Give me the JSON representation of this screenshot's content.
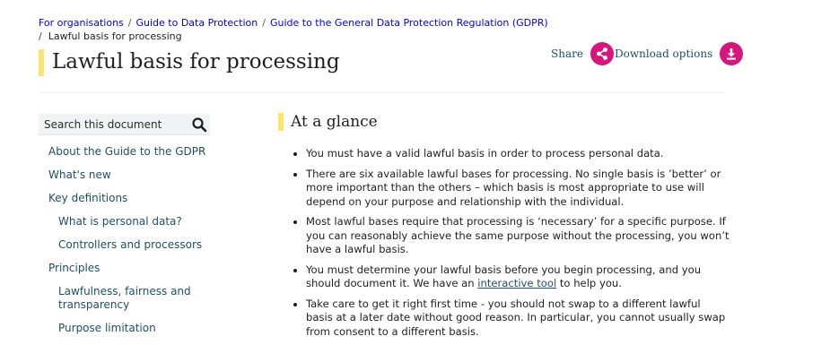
{
  "breadcrumb": {
    "items": [
      "For organisations",
      "Guide to Data Protection",
      "Guide to the General Data Protection Regulation (GDPR)",
      "Lawful basis for processing"
    ],
    "separator": "/"
  },
  "page": {
    "title": "Lawful basis for processing"
  },
  "actions": {
    "share_label": "Share",
    "download_label": "Download options"
  },
  "search": {
    "placeholder": "Search this document"
  },
  "sidebar": {
    "items": [
      {
        "label": "About the Guide to the GDPR",
        "level": 1
      },
      {
        "label": "What's new",
        "level": 1
      },
      {
        "label": "Key definitions",
        "level": 1
      },
      {
        "label": "What is personal data?",
        "level": 2
      },
      {
        "label": "Controllers and processors",
        "level": 2
      },
      {
        "label": "Principles",
        "level": 1
      },
      {
        "label": "Lawfulness, fairness and transparency",
        "level": 2
      },
      {
        "label": "Purpose limitation",
        "level": 2
      }
    ]
  },
  "main": {
    "section_title": "At a glance",
    "bullets": [
      "You must have a valid lawful basis in order to process personal data.",
      "There are six available lawful bases for processing. No single basis is ’better’ or more important than the others – which basis is most appropriate to use will depend on your purpose and relationship with the individual.",
      "Most lawful bases require that processing is ‘necessary’ for a specific purpose. If you can reasonably achieve the same purpose without the processing, you won’t have a lawful basis.",
      {
        "before": "You must determine your lawful basis before you begin processing, and you should document it. We have an ",
        "link": "interactive tool",
        "after": " to help you."
      },
      "Take care to get it right first time - you should not swap to a different lawful basis at a later date without good reason. In particular, you cannot usually swap from consent to a different basis."
    ]
  },
  "colors": {
    "accent_yellow": "#fbe470",
    "brand_pink": "#d6167c",
    "link_blue": "#1f4f65"
  }
}
